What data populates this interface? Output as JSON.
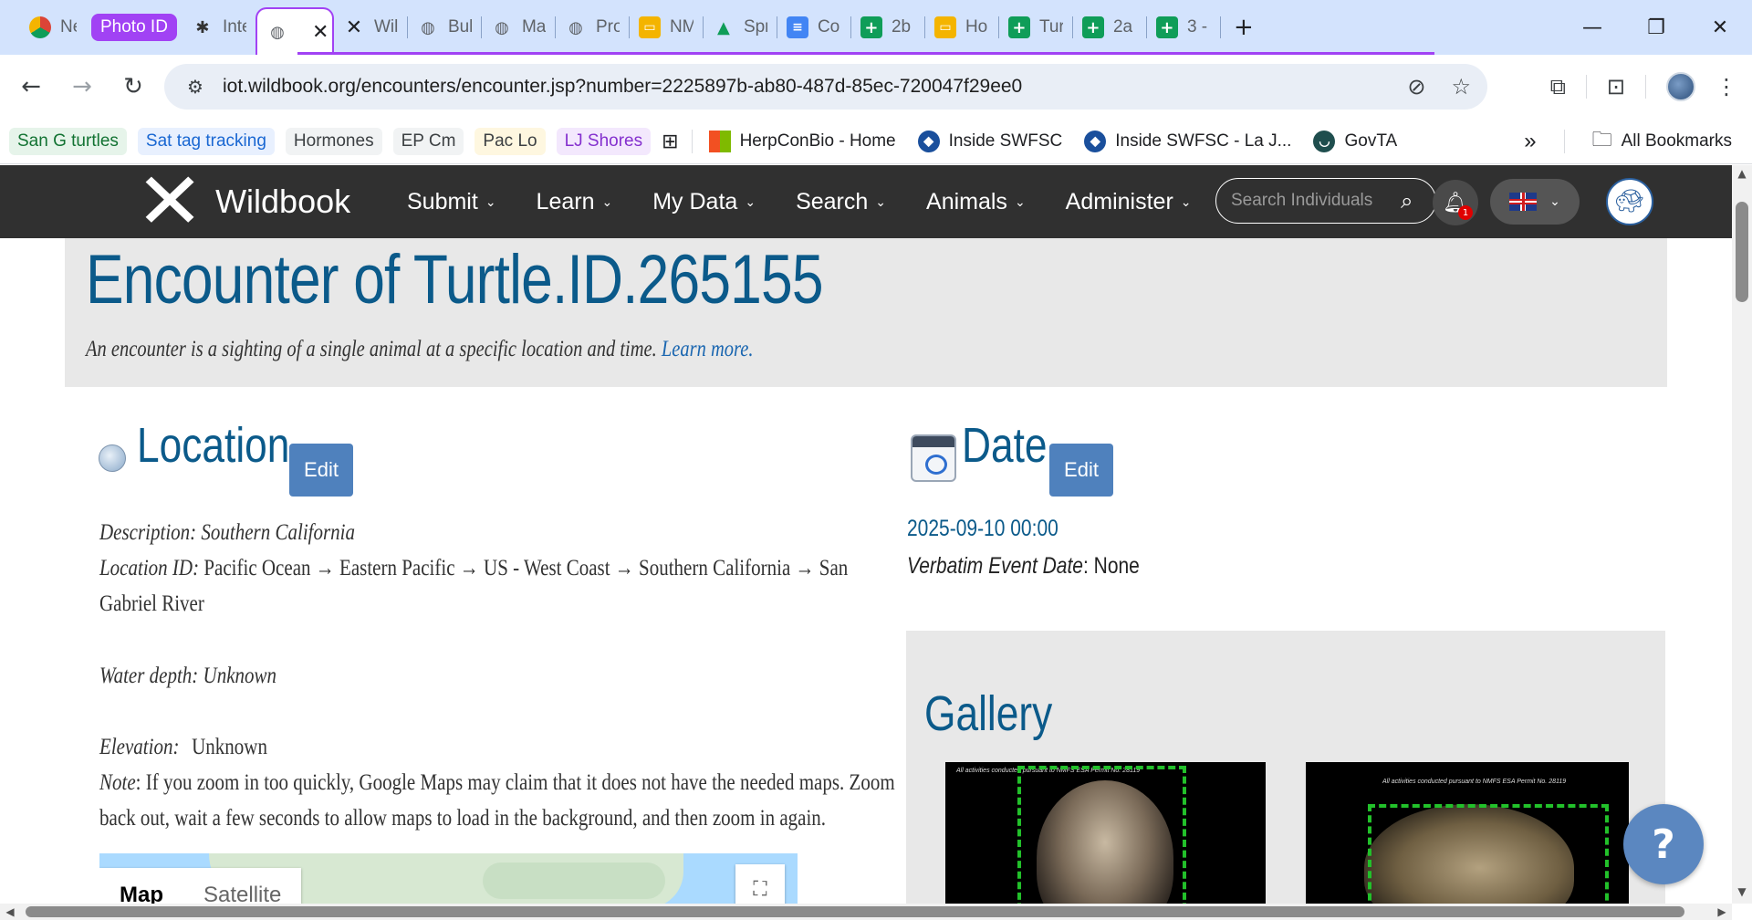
{
  "browser": {
    "tabs": [
      {
        "label": "Nev",
        "icon": "chrome-icon"
      },
      {
        "label": "Photo ID",
        "icon": "group-chip"
      },
      {
        "label": "Inte",
        "icon": "spider-icon"
      },
      {
        "label": "",
        "icon": "globe-icon",
        "active": true
      },
      {
        "label": "Wil",
        "icon": "wildbook-x-icon"
      },
      {
        "label": "Bull",
        "icon": "globe-icon"
      },
      {
        "label": "Ma",
        "icon": "globe-icon"
      },
      {
        "label": "Pro",
        "icon": "globe-icon"
      },
      {
        "label": "NM",
        "icon": "slides-icon"
      },
      {
        "label": "Spr",
        "icon": "drive-icon"
      },
      {
        "label": "Co",
        "icon": "docs-icon"
      },
      {
        "label": "2b",
        "icon": "sheets-icon"
      },
      {
        "label": "Ho",
        "icon": "slides-icon"
      },
      {
        "label": "Tur",
        "icon": "sheets-icon"
      },
      {
        "label": "2a",
        "icon": "sheets-icon"
      },
      {
        "label": "3 -",
        "icon": "sheets-icon"
      }
    ],
    "new_tab": "+",
    "url": "iot.wildbook.org/encounters/encounter.jsp?number=2225897b-ab80-487d-85ec-720047f29ee0",
    "bookmarks_chips": [
      {
        "label": "San G turtles",
        "bg": "#e6f4ea",
        "fg": "#137333"
      },
      {
        "label": "Sat tag tracking",
        "bg": "#e8f0fe",
        "fg": "#1967d2"
      },
      {
        "label": "Hormones",
        "bg": "#f1f3f4",
        "fg": "#3c4043"
      },
      {
        "label": "EP Cm",
        "bg": "#f1f3f4",
        "fg": "#3c4043"
      },
      {
        "label": "Pac Lo",
        "bg": "#fef7e0",
        "fg": "#3c4043"
      },
      {
        "label": "LJ Shores",
        "bg": "#f3e8fd",
        "fg": "#8430ce"
      }
    ],
    "bookmark_links": [
      {
        "label": "HerpConBio - Home",
        "icon": "ms-icon"
      },
      {
        "label": "Inside SWFSC",
        "icon": "noaa-icon"
      },
      {
        "label": "Inside SWFSC - La J...",
        "icon": "noaa-icon"
      },
      {
        "label": "GovTA",
        "icon": "govta-icon"
      }
    ],
    "overflow": "»",
    "all_bookmarks": "All Bookmarks"
  },
  "site": {
    "logo": "Wildbook",
    "menu": [
      "Submit",
      "Learn",
      "My Data",
      "Search",
      "Animals",
      "Administer"
    ],
    "search_placeholder": "Search Individuals",
    "notifications_count": "1"
  },
  "encounter": {
    "title": "Encounter of Turtle.ID.265155",
    "subtitle": "An encounter is a sighting of a single animal at a specific location and time.",
    "learn_more": "Learn more.",
    "location_heading": "Location",
    "date_heading": "Date",
    "edit_label": "Edit",
    "description_label": "Description:",
    "description_value": "Southern California",
    "location_id_label": "Location ID:",
    "location_id_value": "Pacific Ocean → Eastern Pacific → US - West Coast → Southern California → San",
    "location_id_value_2": "Gabriel River",
    "water_depth": "Water depth: Unknown",
    "elevation_label": "Elevation:",
    "elevation_value": "Unknown",
    "note_label": "Note",
    "note_text_1": ": If you zoom in too quickly, Google Maps may claim that it does not have the needed maps. Zoom",
    "note_text_2": "back out, wait a few seconds to allow maps to load in the background, and then zoom in again.",
    "map_tab_map": "Map",
    "map_tab_satellite": "Satellite",
    "date_value": "2025-09-10 00:00",
    "verbatim_label": "Verbatim Event Date",
    "verbatim_value": ": None",
    "gallery_heading": "Gallery",
    "photo1_caption": "All activities conducted pursuant to NMFS ESA Permit No. 28119",
    "photo2_caption": "All activities conducted pursuant to NMFS ESA Permit No. 28119",
    "help": "?"
  },
  "colors": {
    "accent_blue": "#0b5a8a",
    "edit_button": "#4f81bd",
    "tab_group": "#a142f4",
    "nav_bg": "#303030"
  }
}
